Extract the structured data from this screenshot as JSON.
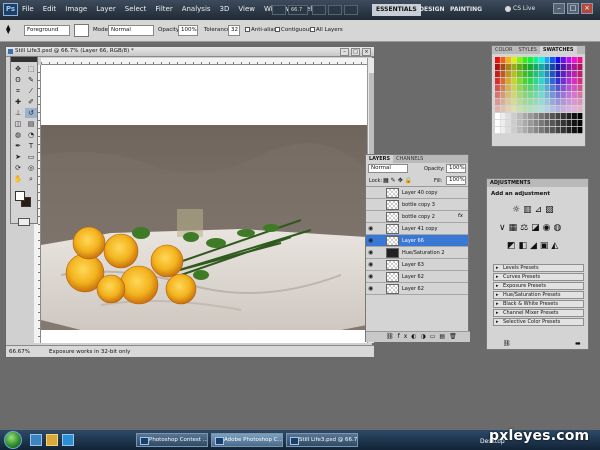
{
  "app": {
    "logo": "Ps",
    "menu": [
      "File",
      "Edit",
      "Image",
      "Layer",
      "Select",
      "Filter",
      "Analysis",
      "3D",
      "View",
      "Window",
      "Help"
    ],
    "zoom_btn": "66.7",
    "workspaces": [
      "ESSENTIALS",
      "DESIGN",
      "PAINTING"
    ],
    "cs_live": "CS Live"
  },
  "options": {
    "tool_mode": "Foreground",
    "mode_label": "Mode:",
    "mode_value": "Normal",
    "opacity_label": "Opacity:",
    "opacity_value": "100%",
    "tolerance_label": "Tolerance:",
    "tolerance_value": "32",
    "antialias": "Anti-alias",
    "contiguous": "Contiguous",
    "all_layers": "All Layers"
  },
  "document": {
    "tab_title": "Still Life3.psd @ 66.7% (Layer 66, RGB/8) *",
    "zoom": "66.67%",
    "status": "Exposure works in 32-bit only"
  },
  "swatches_panel": {
    "tabs": [
      "COLOR",
      "STYLES",
      "SWATCHES"
    ],
    "active_tab": "SWATCHES"
  },
  "layers_panel": {
    "tabs": [
      "LAYERS",
      "CHANNELS"
    ],
    "blend_mode": "Normal",
    "opacity_label": "Opacity:",
    "opacity_value": "100%",
    "lock_label": "Lock:",
    "fill_label": "Fill:",
    "fill_value": "100%",
    "layers": [
      {
        "name": "Layer 40 copy",
        "visible": false
      },
      {
        "name": "bottle copy 3",
        "visible": false
      },
      {
        "name": "bottle copy 2",
        "visible": false,
        "fx": "fx"
      },
      {
        "name": "Layer 41 copy",
        "visible": true
      },
      {
        "name": "Layer 66",
        "visible": true,
        "selected": true
      },
      {
        "name": "Hue/Saturation 2",
        "visible": true
      },
      {
        "name": "Layer 63",
        "visible": true
      },
      {
        "name": "Layer 62",
        "visible": true
      },
      {
        "name": "Layer 62",
        "visible": true
      }
    ]
  },
  "adjustments_panel": {
    "title": "ADJUSTMENTS",
    "heading": "Add an adjustment",
    "presets": [
      "Levels Presets",
      "Curves Presets",
      "Exposure Presets",
      "Hue/Saturation Presets",
      "Black & White Presets",
      "Channel Mixer Presets",
      "Selective Color Presets"
    ]
  },
  "taskbar": {
    "items": [
      "Photoshop Contest ...",
      "Adobe Photoshop C...",
      "Still Life3.psd @ 66.7..."
    ],
    "active_index": 1,
    "desktop_label": "Desktop"
  },
  "watermark": "pxleyes.com",
  "colors": {
    "selection_blue": "#3a78d6",
    "title_dark": "#1f2a36",
    "rose_yellow": "#f2b31d"
  }
}
